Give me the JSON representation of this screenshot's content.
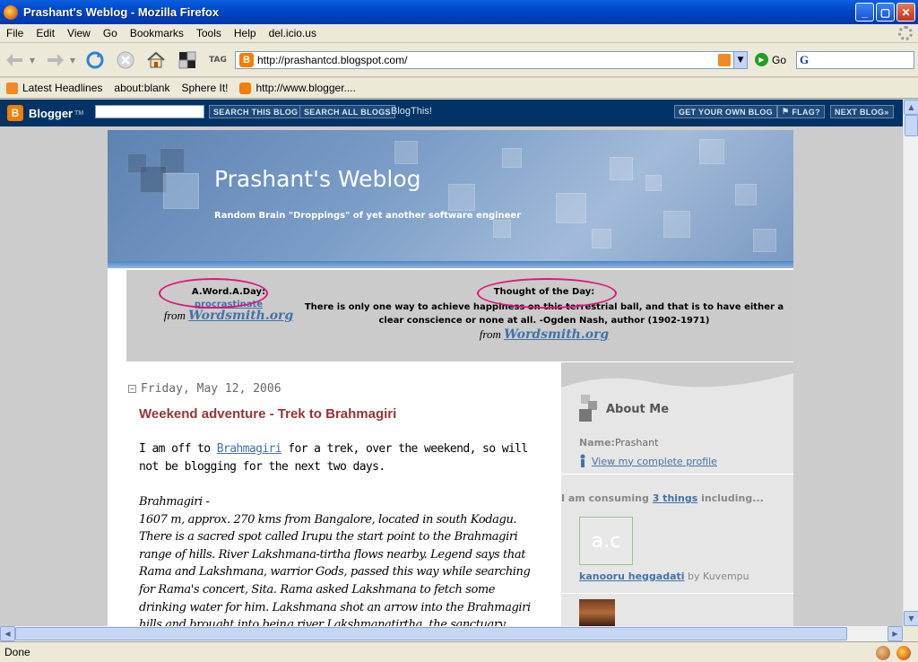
{
  "window": {
    "title": "Prashant's Weblog - Mozilla Firefox",
    "buttons": {
      "minimize": "_",
      "maximize": "▢",
      "close": "✕"
    }
  },
  "menu": [
    "File",
    "Edit",
    "View",
    "Go",
    "Bookmarks",
    "Tools",
    "Help",
    "del.icio.us"
  ],
  "navbar": {
    "url": "http://prashantcd.blogspot.com/",
    "go_label": "Go",
    "tag_label": "TAG",
    "search_placeholder": ""
  },
  "bookmarks": [
    {
      "label": "Latest Headlines",
      "icon": "rss-icon"
    },
    {
      "label": "about:blank",
      "icon": "page-icon"
    },
    {
      "label": "Sphere It!",
      "icon": "page-icon"
    },
    {
      "label": "http://www.blogger....",
      "icon": "blogger-icon"
    }
  ],
  "blogger_nav": {
    "logo": "Blogger",
    "logo_mark": "B",
    "tm": "TM",
    "search_this_blog": "SEARCH THIS BLOG",
    "search_all_blogs": "SEARCH ALL BLOGS",
    "blogthis": "BlogThis!",
    "get_own_blog": "GET YOUR OWN BLOG",
    "flag": "FLAG?",
    "next_blog": "NEXT BLOG»"
  },
  "header": {
    "title": "Prashant's Weblog",
    "description": "Random Brain \"Droppings\" of yet another software engineer"
  },
  "word_a_day": {
    "heading": "A.Word.A.Day:",
    "word": "procrastinate",
    "from_label": "from",
    "source": "Wordsmith.org"
  },
  "thought_of_day": {
    "heading": "Thought of the Day:",
    "quote": "There is only one way to achieve happiness on this terrestrial ball, and that is to have either a clear conscience or none at all. -Ogden Nash, author (1902-1971)",
    "from_label": "from",
    "source": "Wordsmith.org"
  },
  "post": {
    "date": "Friday, May 12, 2006",
    "title": "Weekend adventure - Trek to Brahmagiri",
    "intro_pre": "I am off to ",
    "intro_link": "Brahmagiri",
    "intro_post": " for a trek, over the weekend, so will not be blogging for the next two days.",
    "quote_title": "Brahmagiri -",
    "quote_body": "1607 m, approx. 270 kms from Bangalore, located in south Kodagu. There is a sacred spot called Irupu the start point to the Brahmagiri range of hills. River Lakshmana-tirtha flows nearby. Legend says that Rama and Lakshmana, warrior Gods, passed this way while searching for Rama's concert, Sita. Rama asked Lakshmana to fetch some drinking water for him. Lakshmana shot an arrow into the Brahmagiri hills and brought into being river Lakshmanatirtha, the sanctuary"
  },
  "sidebar": {
    "about_title": "About Me",
    "name_label": "Name:",
    "name_value": "Prashant",
    "profile_link": "View my complete profile",
    "consuming_pre": "I am consuming ",
    "consuming_link": "3 things",
    "consuming_post": " including...",
    "thumb_text": "a.c",
    "book_title": "kanooru heggadati",
    "book_by": " by Kuvempu"
  },
  "status": {
    "text": "Done"
  },
  "colors": {
    "titlebar": "#0046c8",
    "post_title": "#993333",
    "link": "#4472a8",
    "annotation_ellipse": "#e0157a",
    "blogger_bar": "#003366"
  }
}
